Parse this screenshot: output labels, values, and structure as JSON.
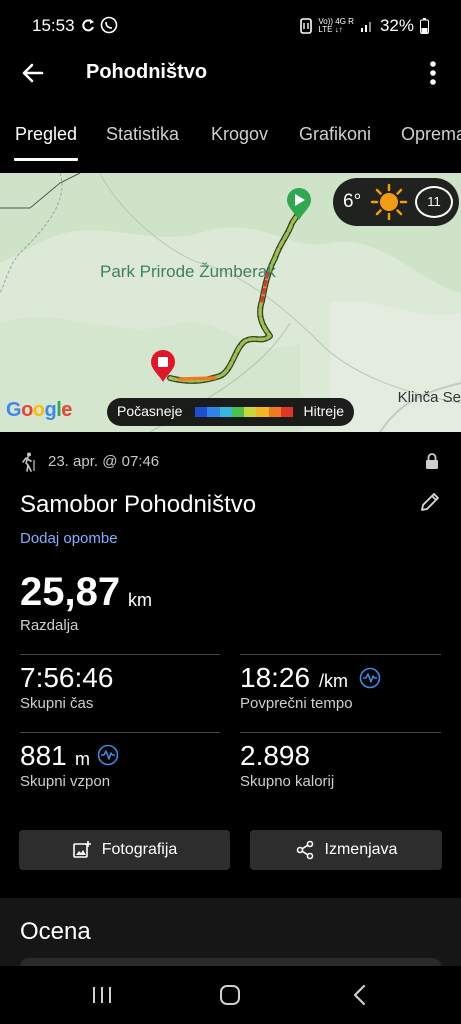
{
  "status_bar": {
    "time": "15:53",
    "network_top": "Vo)) 4G R",
    "network_bottom": "LTE ↓↑",
    "battery": "32%"
  },
  "header": {
    "title": "Pohodništvo"
  },
  "tabs": [
    {
      "label": "Pregled",
      "active": true
    },
    {
      "label": "Statistika",
      "active": false
    },
    {
      "label": "Krogov",
      "active": false
    },
    {
      "label": "Grafikoni",
      "active": false
    },
    {
      "label": "Opremа",
      "active": false
    }
  ],
  "map": {
    "park_label": "Park Prirode Žumberak",
    "town_label": "Klinča Se",
    "google_letters": [
      "G",
      "o",
      "o",
      "g",
      "l",
      "e"
    ],
    "google_colors": [
      "#4285F4",
      "#EA4335",
      "#FBBC05",
      "#4285F4",
      "#34A853",
      "#EA4335"
    ],
    "weather": {
      "temperature": "6°",
      "wind": "11"
    },
    "legend": {
      "slow_label": "Počasneje",
      "fast_label": "Hitreje",
      "colors": [
        "#1f4fd1",
        "#2f86e6",
        "#35b7e0",
        "#4cc04a",
        "#c8d83a",
        "#f2b824",
        "#ef7a22",
        "#e2352a"
      ]
    }
  },
  "activity": {
    "date": "23. apr. @ 07:46",
    "title": "Samobor Pohodništvo",
    "add_notes": "Dodaj opombe",
    "distance_value": "25,87",
    "distance_unit": "km",
    "distance_label": "Razdalja"
  },
  "stats": {
    "total_time": {
      "value": "7:56:46",
      "label": "Skupni čas"
    },
    "avg_pace": {
      "value": "18:26",
      "unit": "/km",
      "label": "Povprečni tempo"
    },
    "ascent": {
      "value": "881",
      "unit": "m",
      "label": "Skupni vzpon"
    },
    "calories": {
      "value": "2.898",
      "label": "Skupno kalorij"
    }
  },
  "actions": {
    "photo_label": "Fotografija",
    "share_label": "Izmenjava"
  },
  "section": {
    "title": "Ocena"
  },
  "colors": {
    "accent_link": "#7fb0ff",
    "pace_icon": "#3a8ee6",
    "start_marker": "#2fa84f",
    "end_marker": "#e0162b"
  }
}
